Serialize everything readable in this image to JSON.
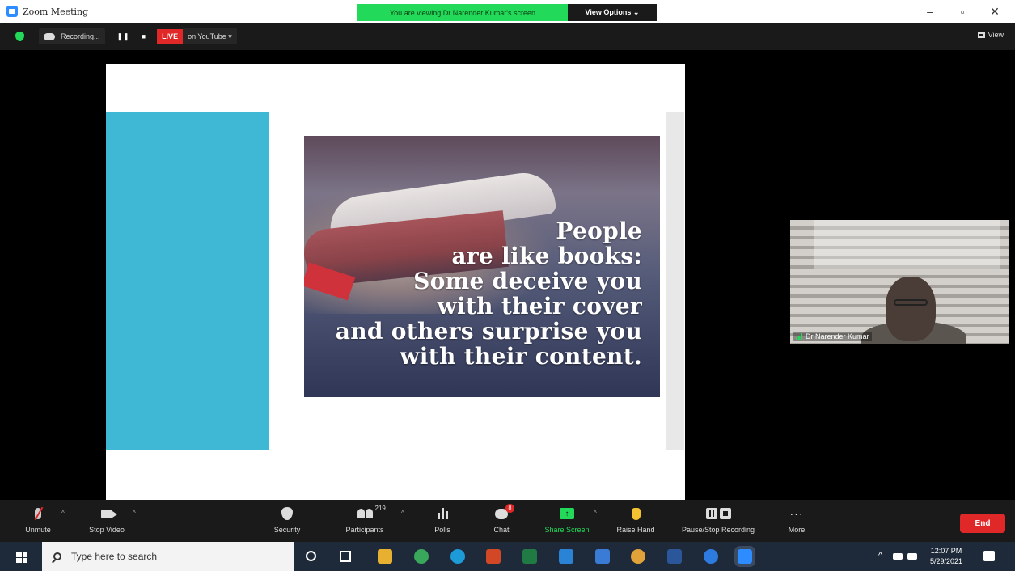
{
  "window": {
    "title": "Zoom Meeting",
    "controls": [
      "–",
      "▫",
      "✕"
    ]
  },
  "banner": {
    "viewing_text": "You are viewing Dr Narender Kumar's screen",
    "view_options_label": "View Options ⌄"
  },
  "topbar": {
    "recording_label": "Recording...",
    "pause_symbol": "❚❚",
    "stop_symbol": "■",
    "live_label": "LIVE",
    "youtube_label": "on YouTube ▾",
    "view_label": "View"
  },
  "slide": {
    "quote_lines": [
      "People",
      "are like books:",
      "Some deceive you",
      "with their cover",
      "and others surprise you",
      "with their content."
    ],
    "accent_color": "#3fb8d6"
  },
  "participant": {
    "name": "Dr Narender Kumar"
  },
  "toolbar": {
    "unmute_label": "Unmute",
    "stop_video_label": "Stop Video",
    "security_label": "Security",
    "participants_label": "Participants",
    "participants_count": "219",
    "polls_label": "Polls",
    "chat_label": "Chat",
    "chat_badge": "8",
    "share_screen_label": "Share Screen",
    "raise_hand_label": "Raise Hand",
    "pause_stop_recording_label": "Pause/Stop Recording",
    "more_label": "More",
    "more_symbol": "···",
    "end_label": "End",
    "caret": "^"
  },
  "taskbar": {
    "search_placeholder": "Type here to search",
    "time": "12:07 PM",
    "date": "5/29/2021",
    "up_arrow": "^"
  },
  "colors": {
    "accent_green": "#23d959",
    "end_red": "#e02828",
    "zoom_blue": "#2d8cff"
  }
}
